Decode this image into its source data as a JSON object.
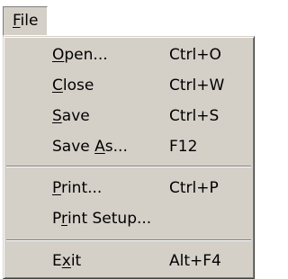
{
  "menubar": {
    "file": {
      "pre": "",
      "key": "F",
      "post": "ile"
    }
  },
  "menu": {
    "items": [
      {
        "pre": "",
        "key": "O",
        "post": "pen...",
        "accel": "Ctrl+O"
      },
      {
        "pre": "",
        "key": "C",
        "post": "lose",
        "accel": "Ctrl+W"
      },
      {
        "pre": "",
        "key": "S",
        "post": "ave",
        "accel": "Ctrl+S"
      },
      {
        "pre": "Save ",
        "key": "A",
        "post": "s...",
        "accel": "F12"
      },
      {
        "pre": "",
        "key": "P",
        "post": "rint...",
        "accel": "Ctrl+P"
      },
      {
        "pre": "P",
        "key": "r",
        "post": "int Setup...",
        "accel": ""
      },
      {
        "pre": "E",
        "key": "x",
        "post": "it",
        "accel": "Alt+F4"
      }
    ]
  },
  "colors": {
    "face": "#d4d0c8",
    "shadow": "#808080",
    "highlight": "#ffffff",
    "dark_shadow": "#404040",
    "text": "#000000"
  }
}
